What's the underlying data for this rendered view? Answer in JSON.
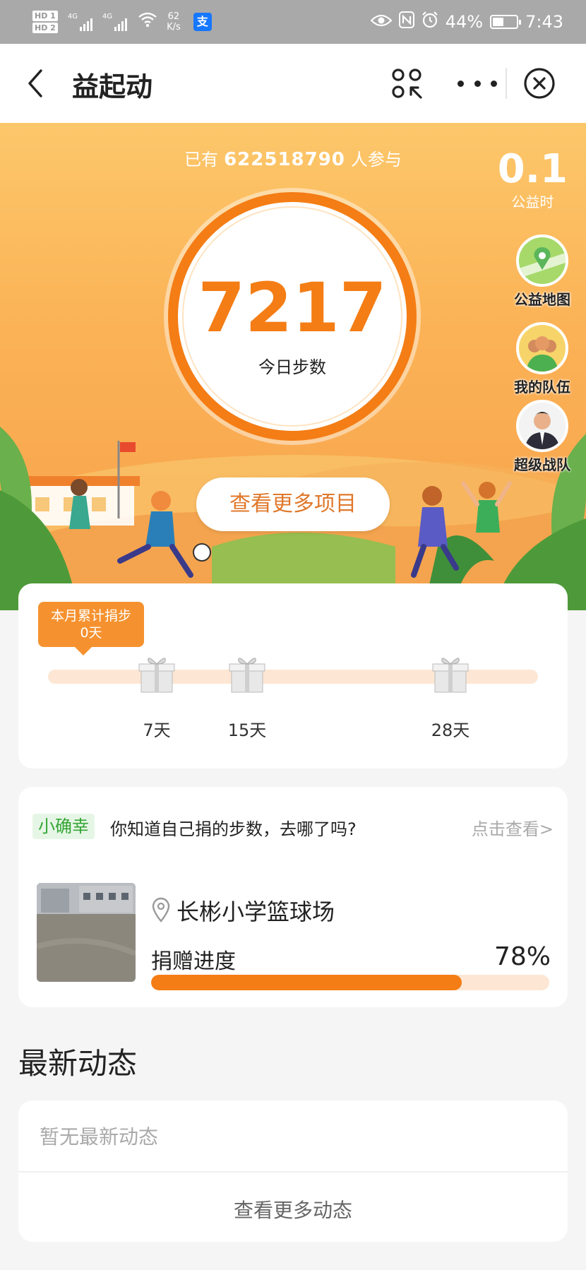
{
  "status_bar": {
    "hd1": "HD 1",
    "hd2": "HD 2",
    "net1": "4G",
    "net2": "4G",
    "speed_val": "62",
    "speed_unit": "K/s",
    "battery": "44%",
    "time": "7:43",
    "app_badge": "支"
  },
  "nav": {
    "title": "益起动"
  },
  "hero": {
    "participants_prefix": "已有",
    "participants_count": "622518790",
    "participants_suffix": "人参与",
    "hours_value": "0.1",
    "hours_label": "公益时",
    "steps_value": "7217",
    "steps_label": "今日步数",
    "more_projects": "查看更多项目",
    "side_buttons": {
      "map": "公益地图",
      "team": "我的队伍",
      "super_team": "超级战队"
    }
  },
  "monthly": {
    "tag_line1": "本月累计捐步",
    "tag_line2": "0天",
    "days_progress": 0,
    "milestones": [
      "7天",
      "15天",
      "28天"
    ]
  },
  "happiness": {
    "tag": "小确幸",
    "question": "你知道自己捐的步数，去哪了吗?",
    "link": "点击查看>",
    "project_name": "长彬小学篮球场",
    "progress_label": "捐赠进度",
    "progress_text": "78%",
    "progress_fraction": 0.78
  },
  "news": {
    "title": "最新动态",
    "empty": "暂无最新动态",
    "more": "查看更多动态"
  },
  "colors": {
    "accent": "#f47d15",
    "hero_bg": "#fbb155",
    "green_tag": "#35a535"
  }
}
